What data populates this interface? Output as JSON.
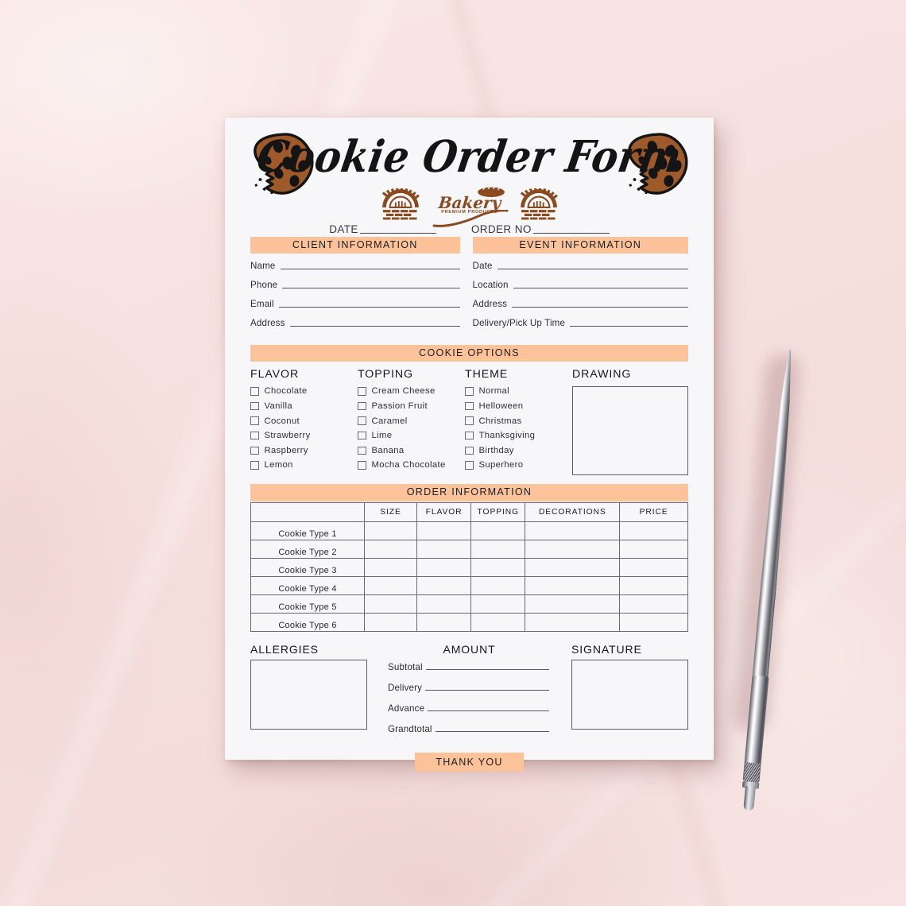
{
  "scene": {
    "background_color": "#f7e3e1",
    "paper_color": "#f7f7fa",
    "accent_color": "#fcc39a",
    "cookie_color": "#9e5a2a",
    "pen_name": "silver-ballpoint-pen"
  },
  "header": {
    "title": "Cookie Order Form",
    "logo": {
      "brand": "Bakery",
      "tagline": "PREMIUM PRODUCTS"
    },
    "date_label": "DATE",
    "order_no_label": "ORDER NO"
  },
  "client_section": {
    "band_title": "CLIENT INFORMATION",
    "fields": [
      {
        "label": "Name"
      },
      {
        "label": "Phone"
      },
      {
        "label": "Email"
      },
      {
        "label": "Address"
      }
    ]
  },
  "event_section": {
    "band_title": "EVENT INFORMATION",
    "fields": [
      {
        "label": "Date"
      },
      {
        "label": "Location"
      },
      {
        "label": "Address"
      },
      {
        "label": "Delivery/Pick Up Time"
      }
    ]
  },
  "cookie_options": {
    "band_title": "COOKIE OPTIONS",
    "columns": [
      {
        "heading": "FLAVOR",
        "items": [
          "Chocolate",
          "Vanilla",
          "Coconut",
          "Strawberry",
          "Raspberry",
          "Lemon"
        ]
      },
      {
        "heading": "TOPPING",
        "items": [
          "Cream Cheese",
          "Passion Fruit",
          "Caramel",
          "Lime",
          "Banana",
          "Mocha Chocolate"
        ]
      },
      {
        "heading": "THEME",
        "items": [
          "Normal",
          "Helloween",
          "Christmas",
          "Thanksgiving",
          "Birthday",
          "Superhero"
        ]
      }
    ],
    "drawing_heading": "DRAWING"
  },
  "order_section": {
    "band_title": "ORDER INFORMATION",
    "headers": [
      "",
      "SIZE",
      "FLAVOR",
      "TOPPING",
      "DECORATIONS",
      "PRICE"
    ],
    "rows": [
      "Cookie Type 1",
      "Cookie Type 2",
      "Cookie Type 3",
      "Cookie Type 4",
      "Cookie Type 5",
      "Cookie Type 6"
    ]
  },
  "bottom": {
    "allergies_heading": "ALLERGIES",
    "amount_heading": "AMOUNT",
    "signature_heading": "SIGNATURE",
    "amount_rows": [
      {
        "label": "Subtotal"
      },
      {
        "label": "Delivery"
      },
      {
        "label": "Advance"
      },
      {
        "label": "Grandtotal"
      }
    ],
    "thank_you": "THANK YOU"
  }
}
